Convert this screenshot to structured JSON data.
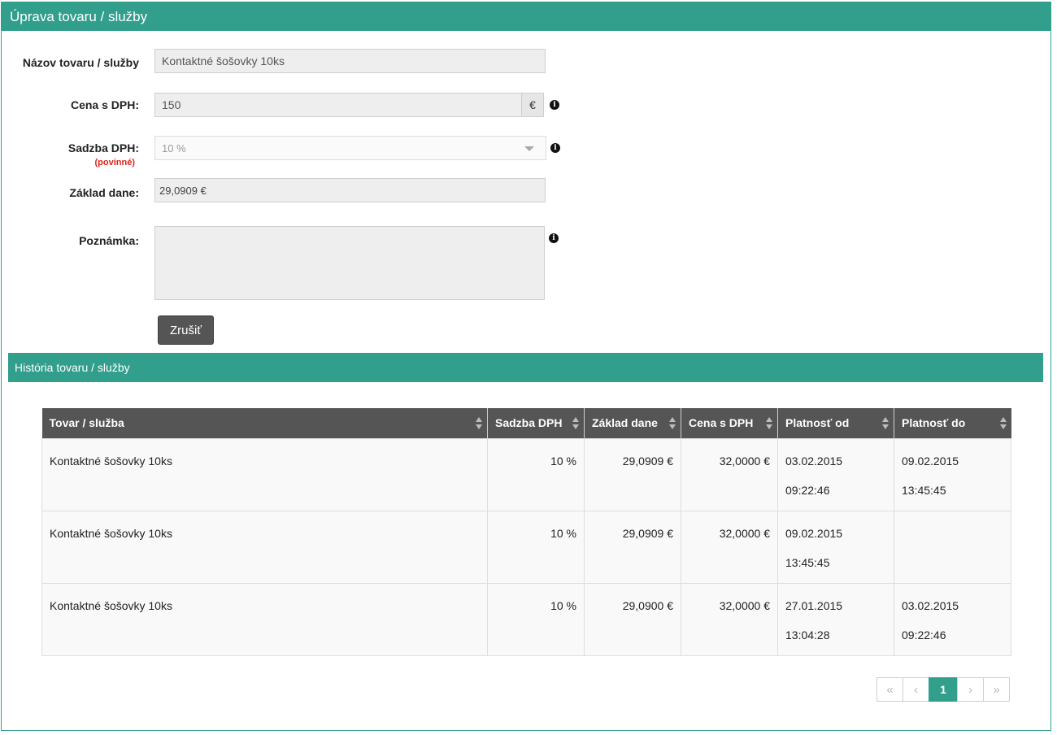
{
  "panel": {
    "title": "Úprava tovaru / služby"
  },
  "form": {
    "name": {
      "label": "Názov tovaru / služby",
      "value": "Kontaktné šošovky 10ks"
    },
    "price": {
      "label": "Cena s DPH:",
      "value": "150",
      "currency": "€"
    },
    "vat_rate": {
      "label": "Sadzba DPH:",
      "required_note": "(povinné)",
      "value": "10 %"
    },
    "tax_base": {
      "label": "Základ dane:",
      "value": "29,0909 €"
    },
    "note": {
      "label": "Poznámka:",
      "value": ""
    },
    "info_icon": "i",
    "cancel_label": "Zrušiť"
  },
  "history": {
    "title": "História tovaru / služby",
    "columns": [
      "Tovar / služba",
      "Sadzba DPH",
      "Základ dane",
      "Cena s DPH",
      "Platnosť od",
      "Platnosť do"
    ],
    "rows": [
      {
        "item": "Kontaktné šošovky 10ks",
        "vat": "10 %",
        "base": "29,0909 €",
        "price": "32,0000 €",
        "from_date": "03.02.2015",
        "from_time": "09:22:46",
        "to_date": "09.02.2015",
        "to_time": "13:45:45"
      },
      {
        "item": "Kontaktné šošovky 10ks",
        "vat": "10 %",
        "base": "29,0909 €",
        "price": "32,0000 €",
        "from_date": "09.02.2015",
        "from_time": "13:45:45",
        "to_date": "",
        "to_time": ""
      },
      {
        "item": "Kontaktné šošovky 10ks",
        "vat": "10 %",
        "base": "29,0900 €",
        "price": "32,0000 €",
        "from_date": "27.01.2015",
        "from_time": "13:04:28",
        "to_date": "03.02.2015",
        "to_time": "09:22:46"
      }
    ]
  },
  "pagination": {
    "first": "«",
    "prev": "‹",
    "current": "1",
    "next": "›",
    "last": "»"
  },
  "colors": {
    "accent": "#329f8d",
    "header_dark": "#555555",
    "required": "#d9261c"
  }
}
